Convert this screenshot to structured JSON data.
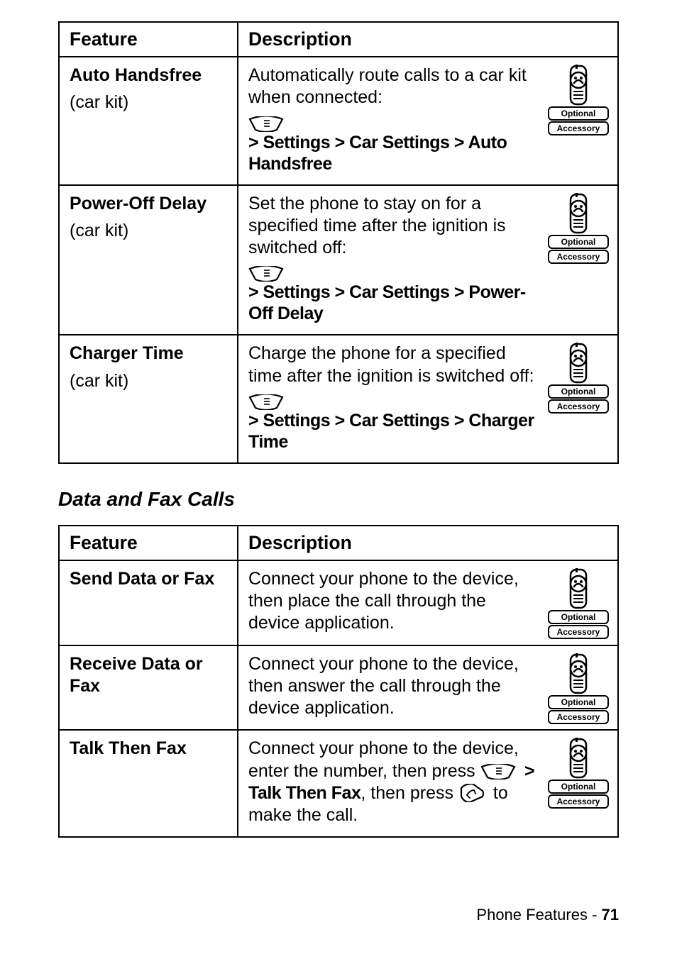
{
  "table1": {
    "headers": {
      "feature": "Feature",
      "description": "Description"
    },
    "rows": [
      {
        "title": "Auto Handsfree",
        "sub": "(car kit)",
        "desc": "Automatically route calls to a car kit when connected:",
        "menu": " > Settings > Car Settings > Auto Handsfree"
      },
      {
        "title": "Power-Off Delay",
        "sub": "(car kit)",
        "desc": "Set the phone to stay on for a specified time after the ignition is switched off:",
        "menu": " > Settings > Car Settings > Power-Off Delay"
      },
      {
        "title": "Charger Time",
        "sub": "(car kit)",
        "desc": "Charge the phone for a specified time after the ignition is switched off:",
        "menu": " > Settings > Car Settings > Charger Time"
      }
    ]
  },
  "section_heading": "Data and Fax Calls",
  "table2": {
    "headers": {
      "feature": "Feature",
      "description": "Description"
    },
    "rows": [
      {
        "title": "Send Data or Fax",
        "desc": "Connect your phone to the device, then place the call through the device application."
      },
      {
        "title": "Receive Data or Fax",
        "desc": "Connect your phone to the device, then answer the call through the device application."
      },
      {
        "title": "Talk Then Fax",
        "desc_prefix": "Connect your phone to the device, enter the number, then press",
        "menu_mid": " > Talk Then Fax",
        "desc_mid": ", then press",
        "desc_suffix": " to make the call."
      }
    ]
  },
  "badge": {
    "line1": "Optional",
    "line2": "Accessory"
  },
  "footer": {
    "label": "Phone Features - ",
    "page": "71"
  }
}
